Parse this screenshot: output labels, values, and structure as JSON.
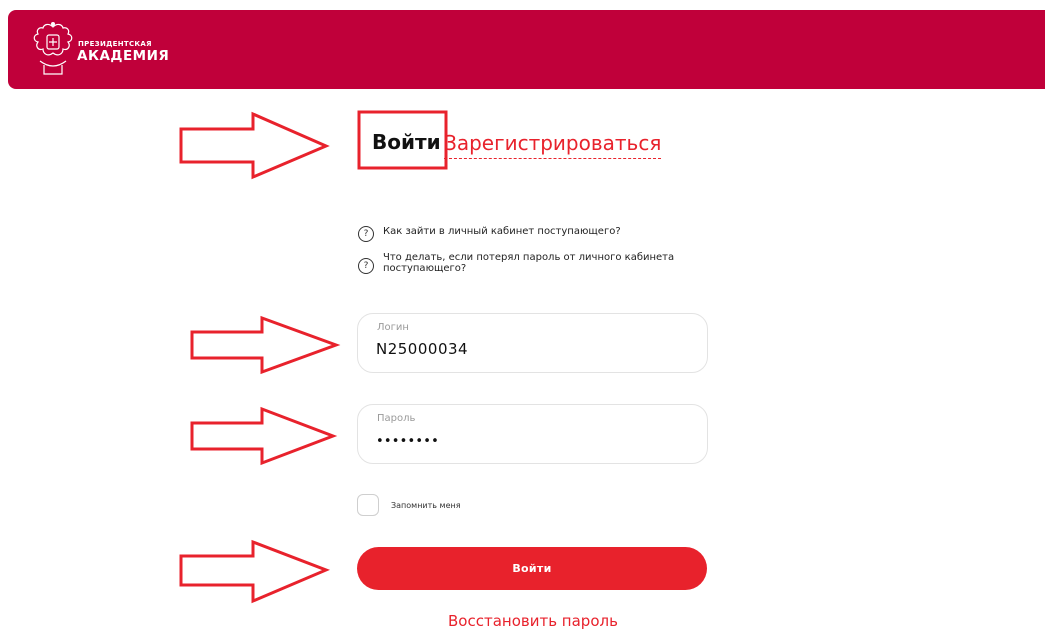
{
  "header": {
    "logo_line1": "ПРЕЗИДЕНТСКАЯ",
    "logo_line2": "АКАДЕМИЯ",
    "brand_color": "#c0003a"
  },
  "tabs": {
    "login": "Войти",
    "register": "Зарегистрироваться"
  },
  "help_links": [
    {
      "icon": "question-icon",
      "text": "Как зайти в личный кабинет поступающего?"
    },
    {
      "icon": "question-icon",
      "text": "Что делать, если потерял пароль от личного кабинета поступающего?"
    }
  ],
  "form": {
    "login_label": "Логин",
    "login_value": "N25000034",
    "password_label": "Пароль",
    "password_value": "••••••••",
    "remember_label": "Запомнить меня",
    "submit_label": "Войти",
    "restore_link": "Восстановить пароль"
  },
  "annotation_color": "#e8222c",
  "accent_color": "#e8222c"
}
